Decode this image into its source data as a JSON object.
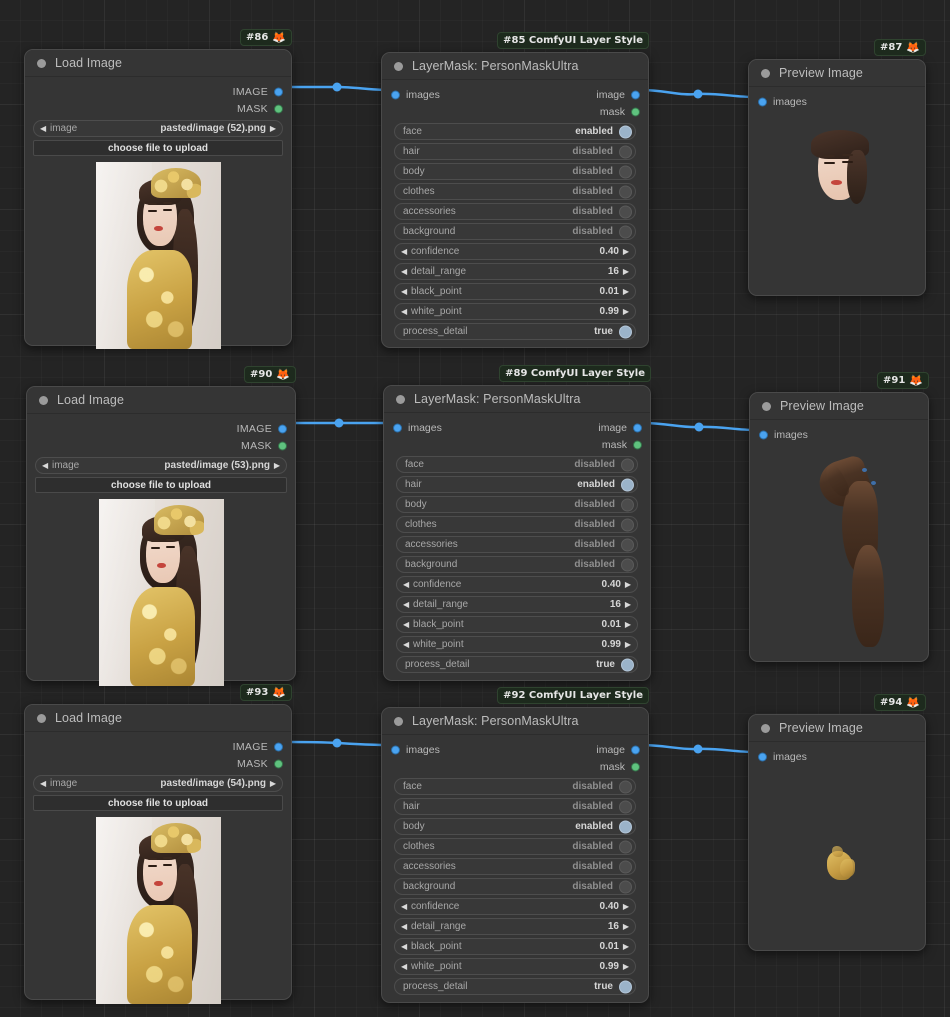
{
  "app": {
    "canvas_background": "#242424",
    "link_color": "#4aa3f0"
  },
  "icons": {
    "collapse_dot": "collapse-dot",
    "fox_badge": "🦊",
    "arrow_left": "◀",
    "arrow_right": "▶"
  },
  "nodes": [
    {
      "id": "86",
      "badge": "#86",
      "badge_emoji": "🦊",
      "title": "Load Image",
      "outputs": [
        {
          "label": "IMAGE",
          "type": "image"
        },
        {
          "label": "MASK",
          "type": "mask"
        }
      ],
      "widgets": [
        {
          "kind": "combo",
          "name": "image",
          "value": "pasted/image (52).png"
        },
        {
          "kind": "button",
          "label": "choose file to upload"
        }
      ]
    },
    {
      "id": "85",
      "badge": "#85 ComfyUI Layer Style",
      "badge_emoji": "",
      "title": "LayerMask: PersonMaskUltra",
      "inputs": [
        {
          "label": "images",
          "type": "image"
        }
      ],
      "outputs": [
        {
          "label": "image",
          "type": "image"
        },
        {
          "label": "mask",
          "type": "mask"
        }
      ],
      "widgets": [
        {
          "kind": "toggle",
          "name": "face",
          "value": "enabled",
          "on": true
        },
        {
          "kind": "toggle",
          "name": "hair",
          "value": "disabled",
          "on": false
        },
        {
          "kind": "toggle",
          "name": "body",
          "value": "disabled",
          "on": false
        },
        {
          "kind": "toggle",
          "name": "clothes",
          "value": "disabled",
          "on": false
        },
        {
          "kind": "toggle",
          "name": "accessories",
          "value": "disabled",
          "on": false
        },
        {
          "kind": "toggle",
          "name": "background",
          "value": "disabled",
          "on": false
        },
        {
          "kind": "stepper",
          "name": "confidence",
          "value": "0.40"
        },
        {
          "kind": "stepper",
          "name": "detail_range",
          "value": "16"
        },
        {
          "kind": "stepper",
          "name": "black_point",
          "value": "0.01"
        },
        {
          "kind": "stepper",
          "name": "white_point",
          "value": "0.99"
        },
        {
          "kind": "toggle",
          "name": "process_detail",
          "value": "true",
          "on": true
        }
      ]
    },
    {
      "id": "87",
      "badge": "#87",
      "badge_emoji": "🦊",
      "title": "Preview Image",
      "inputs": [
        {
          "label": "images",
          "type": "image"
        }
      ],
      "preview": "face-cutout"
    },
    {
      "id": "90",
      "badge": "#90",
      "badge_emoji": "🦊",
      "title": "Load Image",
      "outputs": [
        {
          "label": "IMAGE",
          "type": "image"
        },
        {
          "label": "MASK",
          "type": "mask"
        }
      ],
      "widgets": [
        {
          "kind": "combo",
          "name": "image",
          "value": "pasted/image (53).png"
        },
        {
          "kind": "button",
          "label": "choose file to upload"
        }
      ]
    },
    {
      "id": "89",
      "badge": "#89 ComfyUI Layer Style",
      "badge_emoji": "",
      "title": "LayerMask: PersonMaskUltra",
      "inputs": [
        {
          "label": "images",
          "type": "image"
        }
      ],
      "outputs": [
        {
          "label": "image",
          "type": "image"
        },
        {
          "label": "mask",
          "type": "mask"
        }
      ],
      "widgets": [
        {
          "kind": "toggle",
          "name": "face",
          "value": "disabled",
          "on": false
        },
        {
          "kind": "toggle",
          "name": "hair",
          "value": "enabled",
          "on": true
        },
        {
          "kind": "toggle",
          "name": "body",
          "value": "disabled",
          "on": false
        },
        {
          "kind": "toggle",
          "name": "clothes",
          "value": "disabled",
          "on": false
        },
        {
          "kind": "toggle",
          "name": "accessories",
          "value": "disabled",
          "on": false
        },
        {
          "kind": "toggle",
          "name": "background",
          "value": "disabled",
          "on": false
        },
        {
          "kind": "stepper",
          "name": "confidence",
          "value": "0.40"
        },
        {
          "kind": "stepper",
          "name": "detail_range",
          "value": "16"
        },
        {
          "kind": "stepper",
          "name": "black_point",
          "value": "0.01"
        },
        {
          "kind": "stepper",
          "name": "white_point",
          "value": "0.99"
        },
        {
          "kind": "toggle",
          "name": "process_detail",
          "value": "true",
          "on": true
        }
      ]
    },
    {
      "id": "91",
      "badge": "#91",
      "badge_emoji": "🦊",
      "title": "Preview Image",
      "inputs": [
        {
          "label": "images",
          "type": "image"
        }
      ],
      "preview": "hair-cutout"
    },
    {
      "id": "93",
      "badge": "#93",
      "badge_emoji": "🦊",
      "title": "Load Image",
      "outputs": [
        {
          "label": "IMAGE",
          "type": "image"
        },
        {
          "label": "MASK",
          "type": "mask"
        }
      ],
      "widgets": [
        {
          "kind": "combo",
          "name": "image",
          "value": "pasted/image (54).png"
        },
        {
          "kind": "button",
          "label": "choose file to upload"
        }
      ]
    },
    {
      "id": "92",
      "badge": "#92 ComfyUI Layer Style",
      "badge_emoji": "",
      "title": "LayerMask: PersonMaskUltra",
      "inputs": [
        {
          "label": "images",
          "type": "image"
        }
      ],
      "outputs": [
        {
          "label": "image",
          "type": "image"
        },
        {
          "label": "mask",
          "type": "mask"
        }
      ],
      "widgets": [
        {
          "kind": "toggle",
          "name": "face",
          "value": "disabled",
          "on": false
        },
        {
          "kind": "toggle",
          "name": "hair",
          "value": "disabled",
          "on": false
        },
        {
          "kind": "toggle",
          "name": "body",
          "value": "enabled",
          "on": true
        },
        {
          "kind": "toggle",
          "name": "clothes",
          "value": "disabled",
          "on": false
        },
        {
          "kind": "toggle",
          "name": "accessories",
          "value": "disabled",
          "on": false
        },
        {
          "kind": "toggle",
          "name": "background",
          "value": "disabled",
          "on": false
        },
        {
          "kind": "stepper",
          "name": "confidence",
          "value": "0.40"
        },
        {
          "kind": "stepper",
          "name": "detail_range",
          "value": "16"
        },
        {
          "kind": "stepper",
          "name": "black_point",
          "value": "0.01"
        },
        {
          "kind": "stepper",
          "name": "white_point",
          "value": "0.99"
        },
        {
          "kind": "toggle",
          "name": "process_detail",
          "value": "true",
          "on": true
        }
      ]
    },
    {
      "id": "94",
      "badge": "#94",
      "badge_emoji": "🦊",
      "title": "Preview Image",
      "inputs": [
        {
          "label": "images",
          "type": "image"
        }
      ],
      "preview": "body-cutout"
    }
  ]
}
